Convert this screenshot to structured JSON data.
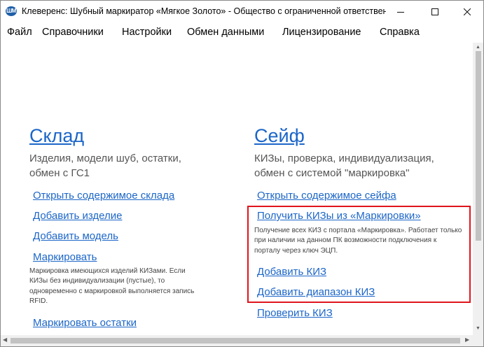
{
  "window": {
    "app_icon_text": "ШМ",
    "title": "Клеверенс: Шубный маркиратор «Мягкое Золото» - Общество с ограниченной ответственн...",
    "icons": {
      "minimize": "minimize-icon",
      "maximize": "maximize-icon",
      "close": "close-icon"
    }
  },
  "menu": {
    "items": [
      "Файл",
      "Справочники",
      "Настройки",
      "Обмен данными",
      "Лицензирование",
      "Справка"
    ]
  },
  "warehouse": {
    "title": "Склад",
    "desc_line1": "Изделия, модели шуб, остатки,",
    "desc_line2": "обмен с ГС1",
    "link_open": "Открыть содержимое склада",
    "link_add_item": "Добавить изделие",
    "link_add_model": "Добавить модель",
    "link_mark": "Маркировать",
    "mark_note": [
      "Маркировка имеющихся изделий КИЗами. Если",
      "КИЗы без индивидуализации (пустые), то",
      "одновременно с маркировкой выполняется запись",
      "RFID."
    ],
    "link_mark_rest": "Маркировать остатки"
  },
  "safe": {
    "title": "Сейф",
    "desc_line1": "КИЗы, проверка, индивидуализация,",
    "desc_line2": "обмен с системой \"маркировка\"",
    "link_open": "Открыть содержимое сейфа",
    "link_get": "Получить КИЗы из «Маркировки»",
    "get_note": [
      "Получение всех КИЗ с портала «Маркировка». Работает только",
      "при наличии на данном ПК возможности подключения к",
      "порталу через ключ ЭЦП."
    ],
    "link_add": "Добавить КИЗ",
    "link_add_range": "Добавить диапазон КИЗ",
    "link_check": "Проверить КИЗ"
  },
  "colors": {
    "link": "#1c66c8",
    "highlight": "#e0141c",
    "desc": "#555555"
  }
}
